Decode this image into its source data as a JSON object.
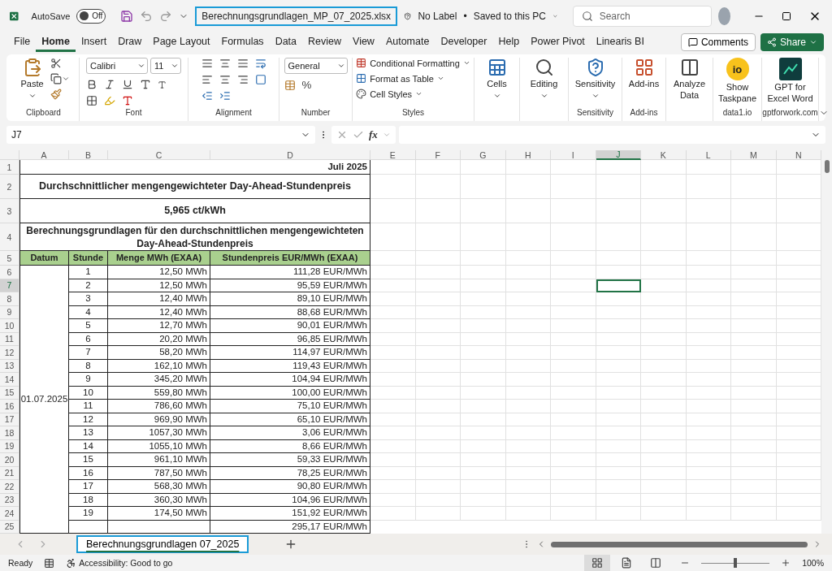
{
  "title_bar": {
    "autosave_label": "AutoSave",
    "autosave": {
      "on": false,
      "label": "Off"
    },
    "filename": "Berechnungsgrundlagen_MP_07_2025.xlsx",
    "sensitivity": "No Label",
    "separator": "•",
    "save_status": "Saved to this PC",
    "search_placeholder": "Search"
  },
  "menu_tabs": [
    {
      "label": "File",
      "selected": false
    },
    {
      "label": "Home",
      "selected": true
    },
    {
      "label": "Insert",
      "selected": false
    },
    {
      "label": "Draw",
      "selected": false
    },
    {
      "label": "Page Layout",
      "selected": false
    },
    {
      "label": "Formulas",
      "selected": false
    },
    {
      "label": "Data",
      "selected": false
    },
    {
      "label": "Review",
      "selected": false
    },
    {
      "label": "View",
      "selected": false
    },
    {
      "label": "Automate",
      "selected": false
    },
    {
      "label": "Developer",
      "selected": false
    },
    {
      "label": "Help",
      "selected": false
    },
    {
      "label": "Power Pivot",
      "selected": false
    },
    {
      "label": "Linearis BI",
      "selected": false
    }
  ],
  "comments_button": "Comments",
  "share_button": "Share",
  "ribbon": {
    "clipboard": {
      "label": "Clipboard",
      "paste": "Paste"
    },
    "font": {
      "label": "Font",
      "font_name": "Calibri",
      "font_size": "11"
    },
    "alignment": {
      "label": "Alignment"
    },
    "number": {
      "label": "Number",
      "format": "General",
      "percent": "%"
    },
    "styles": {
      "label": "Styles",
      "items": [
        {
          "label": "Conditional Formatting",
          "kind": "conditional"
        },
        {
          "label": "Format as Table",
          "kind": "table"
        },
        {
          "label": "Cell Styles",
          "kind": "styles"
        }
      ]
    },
    "big_groups": [
      {
        "buttons": [
          {
            "label": "Cells",
            "kind": "cells",
            "dropdown": true
          }
        ]
      },
      {
        "buttons": [
          {
            "label": "Editing",
            "kind": "editing",
            "dropdown": true
          }
        ]
      },
      {
        "label": "Sensitivity",
        "buttons": [
          {
            "label": "Sensitivity",
            "kind": "sensitivity",
            "dropdown": true
          }
        ]
      },
      {
        "label": "Add-ins",
        "buttons": [
          {
            "label": "Add-ins",
            "kind": "addins"
          }
        ]
      },
      {
        "buttons": [
          {
            "label": "Analyze Data",
            "kind": "analyze"
          }
        ]
      },
      {
        "label": "data1.io",
        "buttons": [
          {
            "label": "Show Taskpane",
            "kind": "taskpane",
            "badge": "io"
          }
        ]
      },
      {
        "label": "gptforwork.com",
        "buttons": [
          {
            "label": "GPT for Excel Word",
            "kind": "gpt"
          }
        ]
      }
    ]
  },
  "formula_bar": {
    "name_box": "J7",
    "fx": "fx"
  },
  "sheet": {
    "column_headers": [
      {
        "label": "A",
        "selected": false
      },
      {
        "label": "B",
        "selected": false
      },
      {
        "label": "C",
        "selected": false
      },
      {
        "label": "D",
        "selected": false
      },
      {
        "label": "E",
        "selected": false
      },
      {
        "label": "F",
        "selected": false
      },
      {
        "label": "G",
        "selected": false
      },
      {
        "label": "H",
        "selected": false
      },
      {
        "label": "I",
        "selected": false
      },
      {
        "label": "J",
        "selected": true
      },
      {
        "label": "K",
        "selected": false
      },
      {
        "label": "L",
        "selected": false
      },
      {
        "label": "M",
        "selected": false
      },
      {
        "label": "N",
        "selected": false
      }
    ],
    "row_headers": [
      {
        "label": "1",
        "selected": false
      },
      {
        "label": "2",
        "selected": false
      },
      {
        "label": "3",
        "selected": false
      },
      {
        "label": "4",
        "selected": false
      },
      {
        "label": "5",
        "selected": false
      },
      {
        "label": "6",
        "selected": false
      },
      {
        "label": "7",
        "selected": true
      },
      {
        "label": "8",
        "selected": false
      },
      {
        "label": "9",
        "selected": false
      },
      {
        "label": "10",
        "selected": false
      },
      {
        "label": "11",
        "selected": false
      },
      {
        "label": "12",
        "selected": false
      },
      {
        "label": "13",
        "selected": false
      },
      {
        "label": "14",
        "selected": false
      },
      {
        "label": "15",
        "selected": false
      },
      {
        "label": "16",
        "selected": false
      },
      {
        "label": "17",
        "selected": false
      },
      {
        "label": "18",
        "selected": false
      },
      {
        "label": "19",
        "selected": false
      },
      {
        "label": "20",
        "selected": false
      },
      {
        "label": "21",
        "selected": false
      },
      {
        "label": "22",
        "selected": false
      },
      {
        "label": "23",
        "selected": false
      },
      {
        "label": "24",
        "selected": false
      },
      {
        "label": "25",
        "selected": false
      }
    ],
    "month": "Juli 2025",
    "heading": "Durchschnittlicher mengengewichteter Day-Ahead-Stundenpreis",
    "average": "5,965 ct/kWh",
    "caption": "Berechnungsgrundlagen für den durchschnittlichen mengengewichteten Day-Ahead-Stundenpreis",
    "table_columns": [
      "Datum",
      "Stunde",
      "Menge MWh (EXAA)",
      "Stundenpreis EUR/MWh (EXAA)"
    ],
    "date": "01.07.2025",
    "rows": [
      {
        "hour": "1",
        "volume": "12,50 MWh",
        "price": "111,28 EUR/MWh"
      },
      {
        "hour": "2",
        "volume": "12,50 MWh",
        "price": "95,59 EUR/MWh"
      },
      {
        "hour": "3",
        "volume": "12,40 MWh",
        "price": "89,10 EUR/MWh"
      },
      {
        "hour": "4",
        "volume": "12,40 MWh",
        "price": "88,68 EUR/MWh"
      },
      {
        "hour": "5",
        "volume": "12,70 MWh",
        "price": "90,01 EUR/MWh"
      },
      {
        "hour": "6",
        "volume": "20,20 MWh",
        "price": "96,85 EUR/MWh"
      },
      {
        "hour": "7",
        "volume": "58,20 MWh",
        "price": "114,97 EUR/MWh"
      },
      {
        "hour": "8",
        "volume": "162,10 MWh",
        "price": "119,43 EUR/MWh"
      },
      {
        "hour": "9",
        "volume": "345,20 MWh",
        "price": "104,94 EUR/MWh"
      },
      {
        "hour": "10",
        "volume": "559,80 MWh",
        "price": "100,00 EUR/MWh"
      },
      {
        "hour": "11",
        "volume": "786,60 MWh",
        "price": "75,10 EUR/MWh"
      },
      {
        "hour": "12",
        "volume": "969,90 MWh",
        "price": "65,10 EUR/MWh"
      },
      {
        "hour": "13",
        "volume": "1057,30 MWh",
        "price": "3,06 EUR/MWh"
      },
      {
        "hour": "14",
        "volume": "1055,10 MWh",
        "price": "8,66 EUR/MWh"
      },
      {
        "hour": "15",
        "volume": "961,10 MWh",
        "price": "59,33 EUR/MWh"
      },
      {
        "hour": "16",
        "volume": "787,50 MWh",
        "price": "78,25 EUR/MWh"
      },
      {
        "hour": "17",
        "volume": "568,30 MWh",
        "price": "90,80 EUR/MWh"
      },
      {
        "hour": "18",
        "volume": "360,30 MWh",
        "price": "104,96 EUR/MWh"
      },
      {
        "hour": "19",
        "volume": "174,50 MWh",
        "price": "151,92 EUR/MWh"
      },
      {
        "price": "295,17 EUR/MWh"
      }
    ]
  },
  "sheet_tabs": [
    {
      "label": "Berechnungsgrundlagen 07_2025",
      "selected": true
    }
  ],
  "status_bar": {
    "ready": "Ready",
    "accessibility": "Accessibility: Good to go",
    "views": [
      {
        "kind": "normal",
        "selected": true
      },
      {
        "kind": "page-layout",
        "selected": false
      },
      {
        "kind": "page-break",
        "selected": false
      }
    ],
    "zoom": {
      "level": 0.5,
      "reading": "100%"
    }
  }
}
